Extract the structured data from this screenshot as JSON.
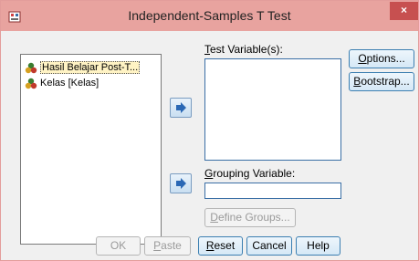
{
  "window": {
    "title": "Independent-Samples T Test",
    "close_glyph": "×",
    "app_icon": "spss-dialog-icon",
    "title_color": "#e8a39f"
  },
  "source_list": {
    "items": [
      {
        "label": "Hasil Belajar Post-T...",
        "icon": "scale-variable-icon",
        "selected": true
      },
      {
        "label": "Kelas [Kelas]",
        "icon": "scale-variable-icon",
        "selected": false
      }
    ]
  },
  "test_variables": {
    "label_accel": "T",
    "label_rest": "est Variable(s):"
  },
  "grouping": {
    "label_accel": "G",
    "label_rest": "rouping Variable:",
    "value": ""
  },
  "buttons": {
    "options_accel": "O",
    "options_rest": "ptions...",
    "bootstrap_accel": "B",
    "bootstrap_rest": "ootstrap...",
    "define_accel": "D",
    "define_rest": "efine Groups...",
    "ok": "OK",
    "paste_accel": "P",
    "paste_rest": "aste",
    "reset_accel": "R",
    "reset_rest": "eset",
    "cancel": "Cancel",
    "help": "Help"
  }
}
